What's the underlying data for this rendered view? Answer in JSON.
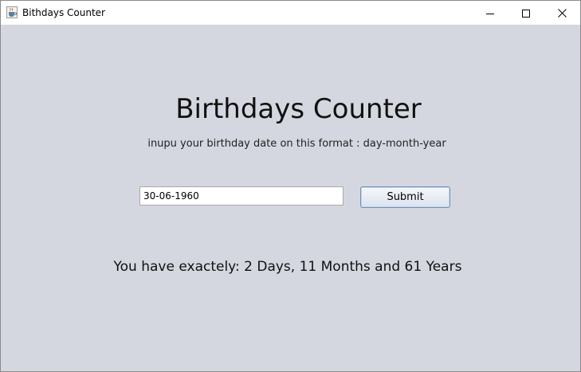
{
  "window": {
    "title": "Bithdays Counter",
    "icons": {
      "app": "java-cup-icon",
      "minimize": "minimize-icon",
      "maximize": "maximize-icon",
      "close": "close-icon"
    }
  },
  "main": {
    "heading": "Birthdays Counter",
    "instructions": "inupu your birthday date on this format :  day-month-year",
    "date_input_value": "30-06-1960",
    "submit_label": "Submit",
    "result_text": "You have exactely: 2 Days, 11 Months and 61 Years"
  },
  "colors": {
    "background": "#d5d7e0",
    "titlebar": "#ffffff",
    "button_border": "#6f8fb3"
  }
}
